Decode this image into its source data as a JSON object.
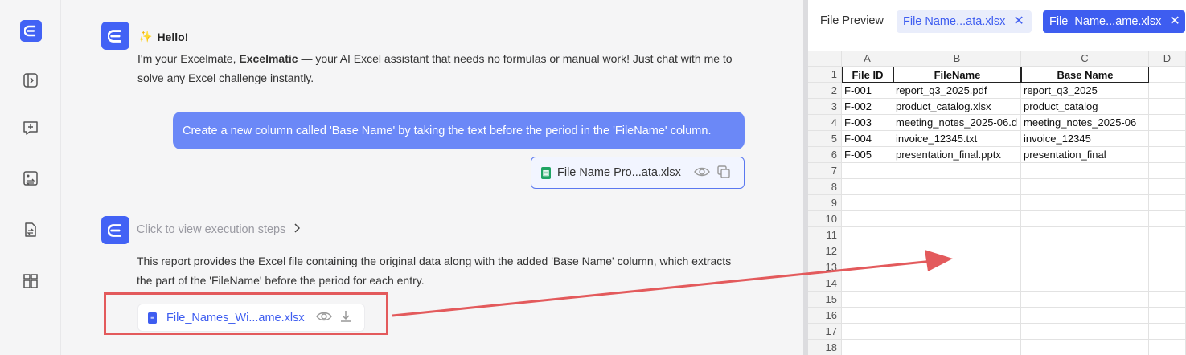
{
  "rail": {
    "items": [
      "logo-icon",
      "sidebar-toggle-icon",
      "new-chat-icon",
      "image-convert-icon",
      "file-convert-icon",
      "layout-icon"
    ]
  },
  "chat": {
    "hello": "Hello!",
    "intro_pre": "I'm your Excelmate, ",
    "intro_brand": "Excelmatic",
    "intro_post": " — your AI Excel assistant that needs no formulas or manual work! Just chat with me to solve any Excel challenge instantly.",
    "user_message": "Create a new column called 'Base Name' by taking the text before the period in the 'FileName' column.",
    "user_file": "File Name Pro...ata.xlsx",
    "steps_label": "Click to view execution steps",
    "report": "This report provides the Excel file containing the original data along with the added 'Base Name' column, which extracts the part of the 'FileName' before the period for each entry.",
    "result_file": "File_Names_Wi...ame.xlsx"
  },
  "preview": {
    "title": "File Preview",
    "tabs": [
      {
        "label": "File Name...ata.xlsx",
        "active": false
      },
      {
        "label": "File_Name...ame.xlsx",
        "active": true
      }
    ],
    "columns": [
      "A",
      "B",
      "C",
      "D"
    ],
    "rows": [
      [
        "File ID",
        "FileName",
        "Base Name"
      ],
      [
        "F-001",
        "report_q3_2025.pdf",
        "report_q3_2025"
      ],
      [
        "F-002",
        "product_catalog.xlsx",
        "product_catalog"
      ],
      [
        "F-003",
        "meeting_notes_2025-06.d",
        "meeting_notes_2025-06"
      ],
      [
        "F-004",
        "invoice_12345.txt",
        "invoice_12345"
      ],
      [
        "F-005",
        "presentation_final.pptx",
        "presentation_final"
      ]
    ],
    "row_numbers": [
      "1",
      "2",
      "3",
      "4",
      "5",
      "6",
      "7",
      "8",
      "9",
      "10",
      "11",
      "12",
      "13",
      "14",
      "15",
      "16",
      "17",
      "18"
    ]
  },
  "colors": {
    "brand": "#4262f5",
    "user_bubble": "#6b88f7",
    "highlight": "#e35a5c"
  }
}
